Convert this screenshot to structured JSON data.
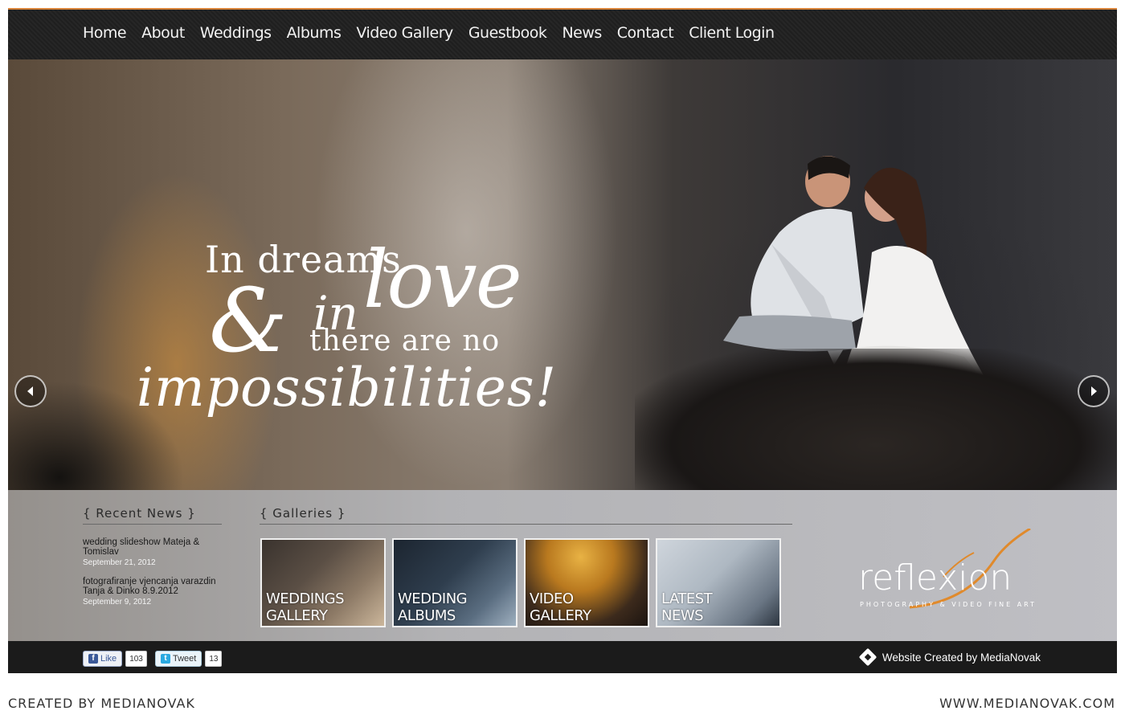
{
  "nav": {
    "items": [
      "Home",
      "About",
      "Weddings",
      "Albums",
      "Video Gallery",
      "Guestbook",
      "News",
      "Contact",
      "Client Login"
    ]
  },
  "hero": {
    "quote_line1": "In dreams",
    "quote_love": "love",
    "quote_amp": "&",
    "quote_in": "in",
    "quote_line3": "there are no",
    "quote_line4": "impossibilities!",
    "prev_icon": "chevron-left-icon",
    "next_icon": "chevron-right-icon"
  },
  "recent_news": {
    "title": "{ Recent News }",
    "items": [
      {
        "title": "wedding slideshow Mateja & Tomislav",
        "date": "September 21, 2012"
      },
      {
        "title": "fotografiranje vjencanja varazdin Tanja & Dinko 8.9.2012",
        "date": "September 9, 2012"
      }
    ]
  },
  "galleries": {
    "title": "{ Galleries }",
    "items": [
      {
        "label": "WEDDINGS\nGALLERY"
      },
      {
        "label": "WEDDING\nALBUMS"
      },
      {
        "label": "VIDEO\nGALLERY"
      },
      {
        "label": "LATEST\nNEWS"
      }
    ]
  },
  "logo": {
    "word": "reflexion",
    "tagline": "PHOTOGRAPHY & VIDEO FINE ART",
    "accent": "#e08a2c"
  },
  "footer": {
    "fb_label": "Like",
    "fb_count": "103",
    "tw_label": "Tweet",
    "tw_count": "13",
    "credit": "Website Created by MediaNovak"
  },
  "outer": {
    "left": "CREATED BY MEDIANOVAK",
    "right": "WWW.MEDIANOVAK.COM"
  }
}
